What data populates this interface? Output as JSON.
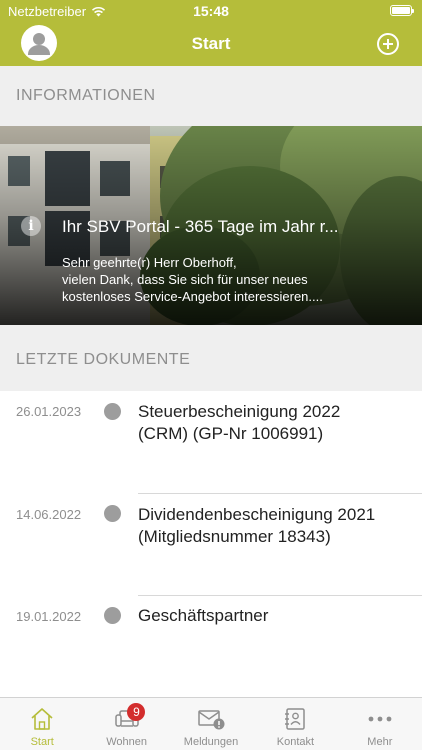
{
  "status_bar": {
    "carrier": "Netzbetreiber",
    "time": "15:48",
    "battery_level": 1.0
  },
  "nav": {
    "title": "Start"
  },
  "info_section": {
    "header": "INFORMATIONEN",
    "card": {
      "title": "Ihr SBV Portal - 365 Tage im Jahr r...",
      "body_lines": [
        "Sehr geehrte(r) Herr Oberhoff,",
        "vielen Dank, dass Sie sich für unser neues",
        "kostenloses Service-Angebot interessieren...."
      ]
    }
  },
  "documents_section": {
    "header": "LETZTE DOKUMENTE",
    "items": [
      {
        "date": "26.01.2023",
        "title_lines": [
          "Steuerbescheinigung 2022",
          "(CRM) (GP-Nr 1006991)"
        ]
      },
      {
        "date": "14.06.2022",
        "title_lines": [
          "Dividendenbescheinigung 2021",
          "(Mitgliedsnummer 18343)"
        ]
      },
      {
        "date": "19.01.2022",
        "title_lines": [
          "Geschäftspartner"
        ]
      }
    ]
  },
  "tab_bar": {
    "active_color": "#b5bd3a",
    "tabs": [
      {
        "label": "Start",
        "icon": "home-icon",
        "active": true
      },
      {
        "label": "Wohnen",
        "icon": "sofa-icon",
        "badge": "9"
      },
      {
        "label": "Meldungen",
        "icon": "envelope-alert-icon"
      },
      {
        "label": "Kontakt",
        "icon": "contact-book-icon"
      },
      {
        "label": "Mehr",
        "icon": "more-dots-icon"
      }
    ]
  },
  "colors": {
    "brand": "#b5bd3a",
    "badge": "#d32d2d",
    "section_bg": "#efefef"
  }
}
